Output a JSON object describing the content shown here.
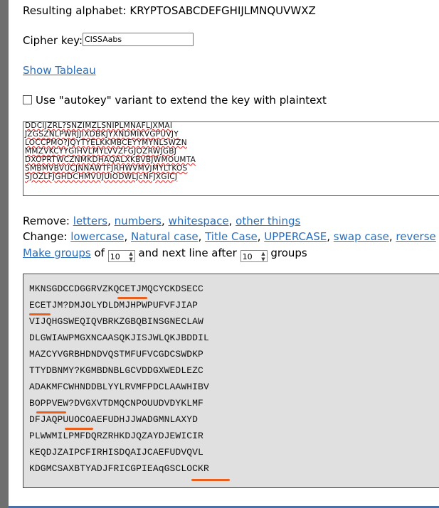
{
  "resulting_alphabet": {
    "label": "Resulting alphabet:",
    "value": "KRYPTOSABCDEFGHIJLMNQUVWXZ"
  },
  "cipher_key": {
    "label": "Cipher key:",
    "value": "CISSAabs"
  },
  "show_tableau_label": "Show Tableau",
  "autokey_label": "Use \"autokey\" variant to extend the key with plaintext",
  "input_lines": [
    "DDCIJZRL?SNZIMZLSNIPLMNAFLJXMAI",
    "JZGSZNLPWRJJIXDBKJYXNDMIKVGPUVJY",
    "LOCCPMO?JQYTYELKKMBCEYYMYNLSWZN",
    "MMZVKCYYGIHVLMYLVVZFGJOZRWJGBJ",
    "DXOPRTWCZNMKDHAQALXKBVBJWMOUMTA",
    "SMBMVBVUCJNNAWTFJRHWVMVJMYLTKOS",
    "SJOZLFJGHDCHMVUJUIODWLJcNFJXGICJ"
  ],
  "remove": {
    "label": "Remove:",
    "links": [
      "letters",
      "numbers",
      "whitespace",
      "other things"
    ]
  },
  "change": {
    "label": "Change:",
    "links": [
      "lowercase",
      "Natural case",
      "Title Case",
      "UPPERCASE",
      "swap case",
      "reverse"
    ]
  },
  "groups": {
    "link": "Make groups",
    "of": "of",
    "group_size": "10",
    "next_line": "and next line after",
    "line_groups": "10",
    "suffix": "groups"
  },
  "output_lines": [
    "MKNSGDCCDGGRVZKQCETJMQCYCKDSECC",
    "ECETJM?DMJOLYDLDMJHPWPUFVFJIAP",
    "VIJQHGSWEQIQVBRKZGBQBINSGNECLAW",
    "DLGWIAWPMGXNCAASQKJISJWLQKJBDDIL",
    "MAZCYVGRBHDNDVQSTMFUFVCGDCSWDKP",
    "TTYDBNMY?KGMBDNBLGCVDDGXWEDLEZC",
    "ADAKMFCWHNDDBLYYLRVMFPDCLAAWHIBV",
    "BOPPVEW?DVGXVTDMQCNPOUUDVDYKLMF",
    "DFJAQPUUOCOAEFUDHJJWADGMNLAXYD",
    "PLWWMILPMFDQRZRHKDJQZAYDJEWICIR",
    "KEQDJZAIPCFIRHISDQAIJCAEFUDVQVL",
    "KDGMCSAXBTYADJFRICGPIEAqGSCLOCKR"
  ],
  "colors": {
    "link": "#2a6ebb",
    "marker": "#e8601c",
    "output_bg": "#e0e0e0"
  }
}
